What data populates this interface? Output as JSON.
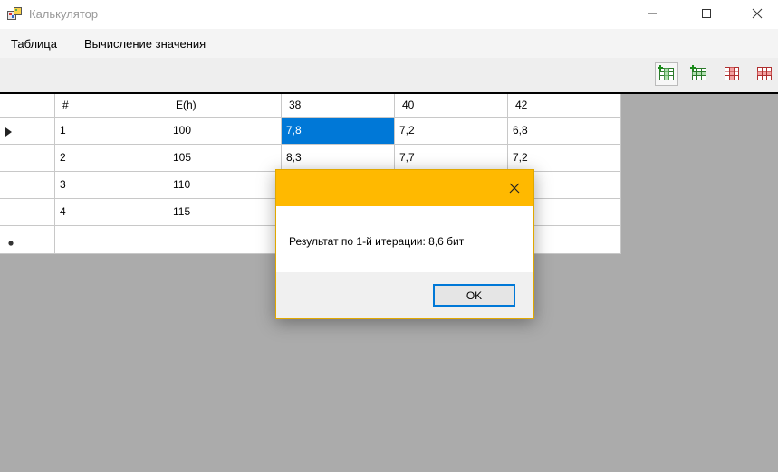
{
  "window": {
    "title": "Калькулятор",
    "icons": [
      "app-icon",
      "minimize-icon",
      "maximize-icon",
      "close-icon"
    ]
  },
  "menu": {
    "items": [
      {
        "label": "Таблица"
      },
      {
        "label": "Вычисление значения"
      }
    ]
  },
  "toolbar": {
    "buttons": [
      {
        "icon": "add-column-icon"
      },
      {
        "icon": "add-row-icon"
      },
      {
        "icon": "delete-column-icon"
      },
      {
        "icon": "delete-row-icon"
      }
    ]
  },
  "grid": {
    "columns": [
      "#",
      "E(h)",
      "38",
      "40",
      "42"
    ],
    "rows": [
      [
        "1",
        "100",
        "7,8",
        "7,2",
        "6,8"
      ],
      [
        "2",
        "105",
        "8,3",
        "7,7",
        "7,2"
      ],
      [
        "3",
        "110",
        "",
        "",
        ""
      ],
      [
        "4",
        "115",
        "",
        "",
        ""
      ]
    ],
    "selected_cell": {
      "row": 0,
      "col": 2
    },
    "colors": {
      "selection": "#0078d7",
      "grid_lines": "#c8c8c8",
      "background_area": "#ababab"
    }
  },
  "dialog": {
    "message": "Результат по 1-й итерации: 8,6 бит",
    "ok_label": "OK",
    "colors": {
      "title_bar": "#ffb900",
      "ok_border": "#0078d7"
    }
  }
}
